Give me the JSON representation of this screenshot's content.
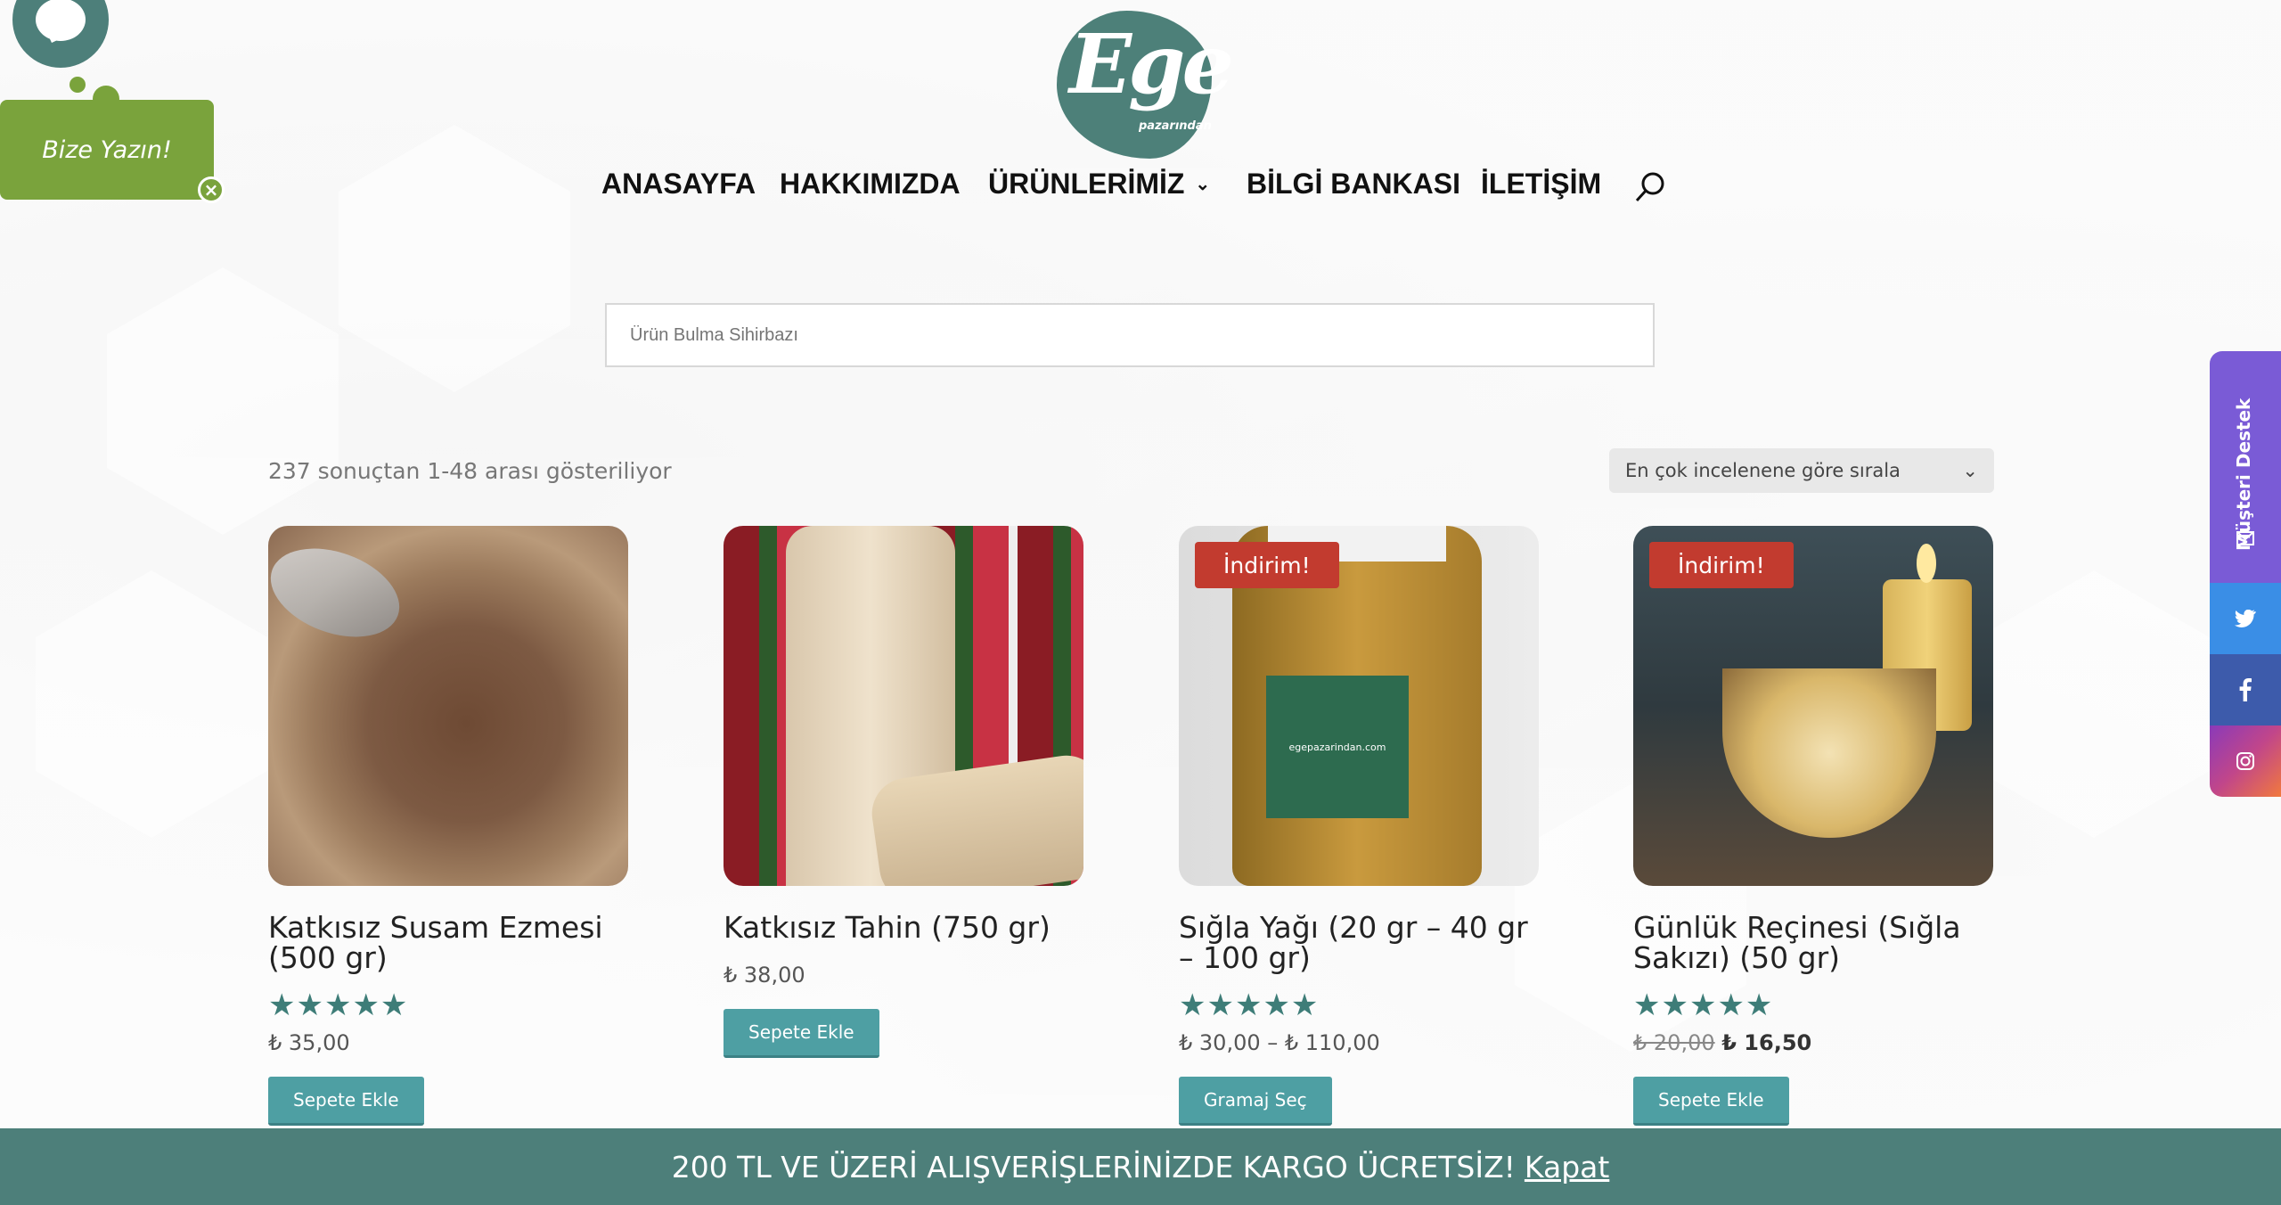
{
  "chat": {
    "label": "Bize Yazın!",
    "close": "×"
  },
  "logo": {
    "big": "Ege",
    "small": "pazarından"
  },
  "nav": {
    "items": [
      "ANASAYFA",
      "HAKKIMIZDA",
      "ÜRÜNLERİMİZ",
      "BİLGİ BANKASI",
      "İLETİŞİM"
    ],
    "dropdown_chevron": "⌄"
  },
  "search": {
    "placeholder": "Ürün Bulma Sihirbazı"
  },
  "results": {
    "count_text": "237 sonuçtan 1-48 arası gösteriliyor"
  },
  "sort": {
    "selected": "En çok incelenene göre sırala",
    "chevron": "⌄"
  },
  "products": [
    {
      "name": "Katkısız Susam Ezmesi (500 gr)",
      "stars": "★★★★★",
      "price": "₺ 35,00",
      "button": "Sepete Ekle"
    },
    {
      "name": "Katkısız Tahin (750 gr)",
      "price": "₺ 38,00",
      "button": "Sepete Ekle"
    },
    {
      "name": "Sığla Yağı (20 gr – 40 gr – 100 gr)",
      "badge": "İndirim!",
      "stars": "★★★★★",
      "price": "₺ 30,00 – ₺ 110,00",
      "button": "Gramaj Seç"
    },
    {
      "name": "Günlük Reçinesi (Sığla Sakızı) (50 gr)",
      "badge": "İndirim!",
      "stars": "★★★★★",
      "old_price": "₺ 20,00",
      "new_price": "₺ 16,50",
      "button": "Sepete Ekle"
    }
  ],
  "jar_label": "egepazarindan.com",
  "side": {
    "support": "Müşteri Destek",
    "twitter_color": "#3a8ee6",
    "facebook_color": "#3d5bab",
    "instagram_color": "#c1468a"
  },
  "banner": {
    "text": "200 TL VE ÜZERİ ALIŞVERİŞLERİNİZDE KARGO ÜCRETSİZ!",
    "link": "Kapat"
  }
}
